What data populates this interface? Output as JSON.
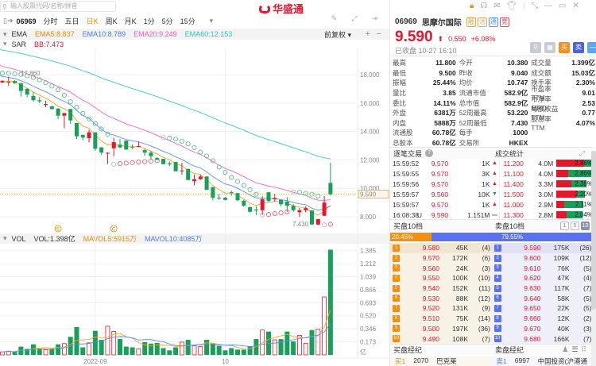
{
  "search": {
    "placeholder": "输入股票代码/名称/拼音"
  },
  "logo": {
    "text": "华盛通"
  },
  "tabs": {
    "code": "06969",
    "items": [
      "分时",
      "五日",
      "日K",
      "周K",
      "月K",
      "1分",
      "5分",
      "15分"
    ],
    "active": "日K",
    "more": "▾"
  },
  "toolbar_icons": [
    "pen-icon",
    "fullscreen-icon",
    "exit-icon"
  ],
  "ema": {
    "name": "EMA",
    "ema5": "EMA5:8.837",
    "ema10": "EMA10:8.789",
    "ema20": "EMA20:9.249",
    "ema60": "EMA60:12.153",
    "adjust": "前复权 ▾",
    "plus": "+",
    "minus": "−"
  },
  "sar": {
    "name": "SAR",
    "bb": "BB:7.473"
  },
  "vol": {
    "name": "VOL",
    "vol": "VOL:1.398亿",
    "mavol5": "MAVOL5:5915万",
    "mavol10": "MAVOL10:4085万"
  },
  "colors": {
    "up": "#e5172f",
    "down": "#16a05a",
    "ema5": "#f5a623",
    "ema10": "#5b8cf5",
    "ema20": "#f266c8",
    "ema60": "#3cc8c4"
  },
  "chart_data": {
    "type": "candlestick",
    "price_ticks": [
      "18.000",
      "16.000",
      "14.000",
      "12.000",
      "10.000",
      "8.000"
    ],
    "price_tick_values": [
      18,
      16,
      14,
      12,
      10,
      8
    ],
    "last_price": "9.590",
    "high_label": "17.860",
    "low_label": "7.430",
    "vol_ticks": [
      "1.385",
      "1.212",
      "1.039",
      "0.866",
      "0.693",
      "0.520",
      "0.346",
      "0.173"
    ],
    "vol_unit": "亿",
    "x_labels": [
      "2022-09",
      "10"
    ],
    "x_label_index": [
      15,
      36
    ],
    "events": [
      {
        "label": "E",
        "index": 9
      },
      {
        "label": "C",
        "index": 18
      }
    ],
    "ema_seeds": {
      "ema5": 17.55,
      "ema10": 17.94,
      "ema20": 18.69,
      "ema60": 19.8
    },
    "ohlc": [
      [
        17.45,
        17.6,
        17.4,
        17.55
      ],
      [
        17.45,
        17.85,
        17.2,
        17.5
      ],
      [
        17.55,
        17.6,
        17.35,
        17.4
      ],
      [
        17.4,
        17.4,
        16.45,
        16.85
      ],
      [
        17.0,
        17.05,
        16.4,
        16.6
      ],
      [
        16.5,
        16.8,
        16.1,
        16.2
      ],
      [
        16.2,
        16.42,
        15.99,
        16.12
      ],
      [
        15.86,
        16.17,
        15.71,
        15.93
      ],
      [
        15.77,
        15.8,
        15.55,
        15.58
      ],
      [
        15.61,
        15.65,
        14.87,
        15.11
      ],
      [
        15.11,
        15.3,
        14.22,
        15.3
      ],
      [
        15.58,
        15.6,
        14.55,
        14.78
      ],
      [
        14.6,
        14.6,
        13.47,
        13.66
      ],
      [
        13.75,
        13.8,
        13.38,
        13.57
      ],
      [
        13.53,
        14.13,
        13.23,
        13.94
      ],
      [
        13.94,
        13.94,
        12.64,
        12.79
      ],
      [
        12.88,
        12.9,
        12.36,
        12.51
      ],
      [
        12.48,
        12.54,
        11.7,
        12.5
      ],
      [
        12.82,
        13.57,
        12.26,
        13.25
      ],
      [
        13.07,
        13.47,
        12.82,
        12.88
      ],
      [
        13.36,
        13.36,
        12.7,
        12.73
      ],
      [
        12.93,
        13.1,
        12.77,
        12.91
      ],
      [
        12.96,
        13.29,
        12.92,
        12.97
      ],
      [
        12.69,
        12.82,
        12.26,
        12.51
      ],
      [
        12.51,
        12.64,
        12.08,
        12.26
      ],
      [
        12.13,
        12.2,
        11.98,
        12.02
      ],
      [
        12.08,
        12.08,
        11.7,
        11.7
      ],
      [
        11.76,
        11.89,
        11.56,
        11.69
      ],
      [
        11.85,
        11.85,
        11.2,
        11.2
      ],
      [
        11.22,
        11.8,
        10.96,
        11.26
      ],
      [
        11.37,
        11.37,
        10.55,
        10.59
      ],
      [
        10.5,
        10.96,
        10.22,
        10.64
      ],
      [
        10.64,
        10.96,
        10.59,
        10.83
      ],
      [
        10.83,
        10.85,
        9.9,
        9.9
      ],
      [
        10.08,
        10.1,
        9.16,
        9.34
      ],
      [
        9.35,
        9.6,
        9.19,
        9.33
      ],
      [
        9.34,
        9.4,
        9.15,
        9.19
      ],
      [
        9.72,
        9.84,
        9.47,
        9.66
      ],
      [
        9.66,
        9.7,
        9.1,
        9.16
      ],
      [
        9.13,
        9.2,
        8.7,
        8.78
      ],
      [
        8.67,
        8.7,
        8.3,
        8.35
      ],
      [
        8.5,
        8.73,
        8.13,
        8.46
      ],
      [
        8.46,
        9.44,
        8.13,
        9.23
      ],
      [
        9.72,
        9.75,
        9.05,
        9.1
      ],
      [
        9.23,
        9.6,
        9.05,
        9.32
      ],
      [
        9.19,
        9.2,
        8.73,
        8.88
      ],
      [
        9.06,
        9.38,
        8.35,
        8.77
      ],
      [
        8.77,
        8.9,
        8.35,
        8.46
      ],
      [
        8.32,
        8.61,
        7.98,
        8.46
      ],
      [
        8.46,
        8.73,
        8.3,
        8.6
      ],
      [
        8.45,
        8.45,
        7.43,
        7.46
      ],
      [
        7.45,
        7.85,
        7.43,
        7.83
      ],
      [
        8.07,
        9.47,
        8.05,
        9.0
      ],
      [
        10.38,
        11.8,
        9.5,
        9.59
      ]
    ],
    "volume_yi": [
      0.04,
      0.05,
      0.04,
      0.11,
      0.08,
      0.14,
      0.08,
      0.07,
      0.08,
      0.14,
      0.15,
      0.24,
      0.37,
      0.1,
      0.16,
      0.32,
      0.2,
      0.38,
      0.31,
      0.21,
      0.11,
      0.1,
      0.08,
      0.17,
      0.15,
      0.16,
      0.09,
      0.06,
      0.1,
      0.17,
      0.2,
      0.12,
      0.11,
      0.2,
      0.15,
      0.12,
      0.06,
      0.09,
      0.07,
      0.07,
      0.11,
      0.21,
      0.33,
      0.31,
      0.2,
      0.21,
      0.31,
      0.18,
      0.26,
      0.155,
      0.33,
      0.34,
      0.77,
      1.398
    ]
  },
  "quote": {
    "code": "06969",
    "name": "思摩尔国际",
    "badges": [
      {
        "t": "融",
        "c": "#f5a040"
      },
      {
        "t": "沽",
        "c": "#e8b060"
      },
      {
        "t": "通",
        "c": "#4a9af5"
      },
      {
        "t": "竞",
        "c": "#e5465a"
      }
    ],
    "price": "9.590",
    "arrow": "⬆",
    "change": "0.550",
    "change_pct": "+6.08%",
    "status": "已收盘 10-27 16:10",
    "actions": [
      {
        "t": "⚲",
        "c": "#c8ccd2"
      },
      {
        "t": "▦",
        "c": "#c8ccd2"
      },
      {
        "t": "买",
        "c": "#f5901e"
      },
      {
        "t": "卖",
        "c": "#4a63e0"
      },
      {
        "t": "—",
        "c": "#5aa8f5"
      }
    ]
  },
  "window_icons": [
    "lock-icon",
    "headset-icon",
    "mail-icon",
    "shirt-icon",
    "shrink-icon",
    "minimize-icon",
    "maximize-icon",
    "close-icon"
  ],
  "stats": [
    [
      [
        "最高",
        "11.800",
        "red"
      ],
      [
        "今开",
        "10.380",
        "red"
      ],
      [
        "成交量",
        "1.399亿",
        ""
      ]
    ],
    [
      [
        "最低",
        "9.500",
        "red"
      ],
      [
        "昨收",
        "9.040",
        ""
      ],
      [
        "成交额",
        "15.03亿",
        ""
      ]
    ],
    [
      [
        "振幅",
        "25.44%",
        ""
      ],
      [
        "均价",
        "10.747",
        "red"
      ],
      [
        "换手率",
        "2.30%",
        ""
      ]
    ],
    [
      [
        "量比",
        "3.85",
        ""
      ],
      [
        "流通市值",
        "582.9亿",
        ""
      ],
      [
        "市盈率TTM",
        "9.01",
        ""
      ]
    ],
    [
      [
        "委比",
        "14.11%",
        ""
      ],
      [
        "总市值",
        "582.9亿",
        ""
      ],
      [
        "市净率MRQ",
        "2.53",
        ""
      ]
    ],
    [
      [
        "外盘",
        "6381万",
        "red"
      ],
      [
        "52周最高",
        "53.220",
        "red"
      ],
      [
        "每股收益TTM",
        "0.77",
        ""
      ]
    ],
    [
      [
        "内盘",
        "5888万",
        "green"
      ],
      [
        "52周最低",
        "7.430",
        "green"
      ],
      [
        "股息率TTM",
        "4.07%",
        ""
      ]
    ],
    [
      [
        "流通股",
        "60.78亿",
        ""
      ],
      [
        "每手",
        "1000",
        ""
      ],
      [
        "",
        "",
        " "
      ]
    ],
    [
      [
        "总股本",
        "60.78亿",
        ""
      ],
      [
        "交易所",
        "HKEX",
        ""
      ],
      [
        "",
        "",
        " "
      ]
    ]
  ],
  "trades_header": {
    "left": "逐笔交易",
    "right": "成交统计",
    "help": "?"
  },
  "trades": [
    {
      "time": "15:59:52",
      "flag": "",
      "price": "9.570",
      "qty": "1K",
      "dir": "up"
    },
    {
      "time": "15:59:55",
      "flag": "",
      "price": "9.570",
      "qty": "3K",
      "dir": "up"
    },
    {
      "time": "15:59:56",
      "flag": "",
      "price": "9.570",
      "qty": "1K",
      "dir": "up"
    },
    {
      "time": "15:59:57",
      "flag": "",
      "price": "9.560",
      "qty": "10K",
      "dir": "down"
    },
    {
      "time": "15:59:57",
      "flag": "",
      "price": "9.570",
      "qty": "1K",
      "dir": "up"
    },
    {
      "time": "16:08:38",
      "flag": "U",
      "price": "9.590",
      "qty": "1.151M",
      "dir": "flat"
    }
  ],
  "volume_stats": [
    {
      "price": "11.200",
      "vol": "4.0M",
      "pct": "2.86%",
      "share": 2.86,
      "buy_ratio": 0.75
    },
    {
      "price": "11.100",
      "vol": "4.0M",
      "pct": "2.86%",
      "share": 2.86,
      "buy_ratio": 0.32
    },
    {
      "price": "11.400",
      "vol": "3.3M",
      "pct": "2.38%",
      "share": 2.38,
      "buy_ratio": 0.48
    },
    {
      "price": "11.500",
      "vol": "3.0M",
      "pct": "2.20%",
      "share": 2.2,
      "buy_ratio": 0.72
    },
    {
      "price": "11.000",
      "vol": "2.9M",
      "pct": "2.11%",
      "share": 2.11,
      "buy_ratio": 0.28
    },
    {
      "price": "11.300",
      "vol": "2.8M",
      "pct": "2.04%",
      "share": 2.04,
      "buy_ratio": 0.4
    }
  ],
  "book_header": {
    "bid": "买盘10档",
    "ask": "卖盘10档",
    "levels": [
      "1",
      "5",
      "10"
    ],
    "active_level": "10"
  },
  "book_ratio": {
    "bid": "20.45%",
    "ask": "79.55%",
    "bid_fraction": 0.2045
  },
  "bids": [
    [
      "1",
      "9.580",
      "45K",
      "(4)"
    ],
    [
      "2",
      "9.570",
      "172K",
      "(6)"
    ],
    [
      "3",
      "9.560",
      "24K",
      "(3)"
    ],
    [
      "4",
      "9.550",
      "100K",
      "(10)"
    ],
    [
      "5",
      "9.540",
      "152K",
      "(11)"
    ],
    [
      "6",
      "9.530",
      "88K",
      "(12)"
    ],
    [
      "7",
      "9.520",
      "131K",
      "(9)"
    ],
    [
      "8",
      "9.510",
      "75K",
      "(14)"
    ],
    [
      "9",
      "9.500",
      "197K",
      "(36)"
    ],
    [
      "10",
      "9.490",
      "108K",
      "(7)"
    ]
  ],
  "asks": [
    [
      "1",
      "9.590",
      "175K",
      "(26)"
    ],
    [
      "2",
      "9.600",
      "109K",
      "(12)"
    ],
    [
      "3",
      "9.610",
      "76K",
      "(5)"
    ],
    [
      "4",
      "9.620",
      "47K",
      "(4)"
    ],
    [
      "5",
      "9.630",
      "117K",
      "(7)"
    ],
    [
      "6",
      "9.640",
      "58K",
      "(5)"
    ],
    [
      "7",
      "9.650",
      "22K",
      "(5)"
    ],
    [
      "8",
      "9.660",
      "12K",
      "(2)"
    ],
    [
      "9",
      "9.670",
      "40K",
      "(3)"
    ],
    [
      "10",
      "9.680",
      "166K",
      "(7)"
    ]
  ],
  "broker_header": {
    "bid": "买盘经纪",
    "ask": "卖盘经纪"
  },
  "brokers": {
    "bid": {
      "label": "买1",
      "id": "2070",
      "name": "巴克莱"
    },
    "ask": {
      "label": "卖1",
      "id": "6997",
      "name": "中国投资(沪港通"
    }
  }
}
